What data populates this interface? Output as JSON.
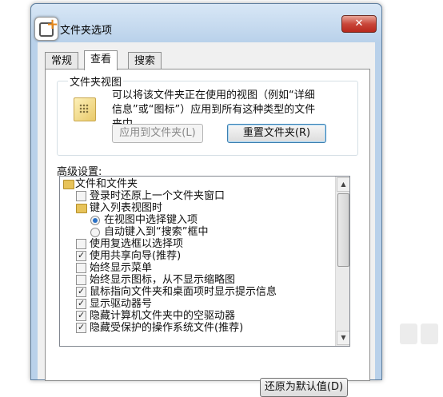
{
  "window": {
    "title": "文件夹选项",
    "close_label": "✕"
  },
  "tabs": [
    {
      "label": "常规"
    },
    {
      "label": "查看"
    },
    {
      "label": "搜索"
    }
  ],
  "folder_views": {
    "group_title": "文件夹视图",
    "description": "可以将该文件夹正在使用的视图（例如“详细信息”或“图标”）应用到所有这种类型的文件夹中。",
    "apply_button": "应用到文件夹(L)",
    "reset_button": "重置文件夹(R)"
  },
  "advanced": {
    "label": "高级设置:",
    "items": [
      {
        "type": "folder",
        "text": "文件和文件夹",
        "level": 0
      },
      {
        "type": "checkbox",
        "text": "登录时还原上一个文件夹窗口",
        "checked": false,
        "level": 1
      },
      {
        "type": "folder",
        "text": "键入列表视图时",
        "level": 1
      },
      {
        "type": "radio",
        "text": "在视图中选择键入项",
        "checked": true,
        "level": 2
      },
      {
        "type": "radio",
        "text": "自动键入到“搜索”框中",
        "checked": false,
        "level": 2
      },
      {
        "type": "checkbox",
        "text": "使用复选框以选择项",
        "checked": false,
        "level": 1
      },
      {
        "type": "checkbox",
        "text": "使用共享向导(推荐)",
        "checked": true,
        "level": 1
      },
      {
        "type": "checkbox",
        "text": "始终显示菜单",
        "checked": false,
        "level": 1
      },
      {
        "type": "checkbox",
        "text": "始终显示图标，从不显示缩略图",
        "checked": false,
        "level": 1
      },
      {
        "type": "checkbox",
        "text": "鼠标指向文件夹和桌面项时显示提示信息",
        "checked": true,
        "level": 1
      },
      {
        "type": "checkbox",
        "text": "显示驱动器号",
        "checked": true,
        "level": 1
      },
      {
        "type": "checkbox",
        "text": "隐藏计算机文件夹中的空驱动器",
        "checked": true,
        "level": 1
      },
      {
        "type": "checkbox",
        "text": "隐藏受保护的操作系统文件(推荐)",
        "checked": true,
        "level": 1
      }
    ],
    "restore_button": "还原为默认值(D)"
  }
}
